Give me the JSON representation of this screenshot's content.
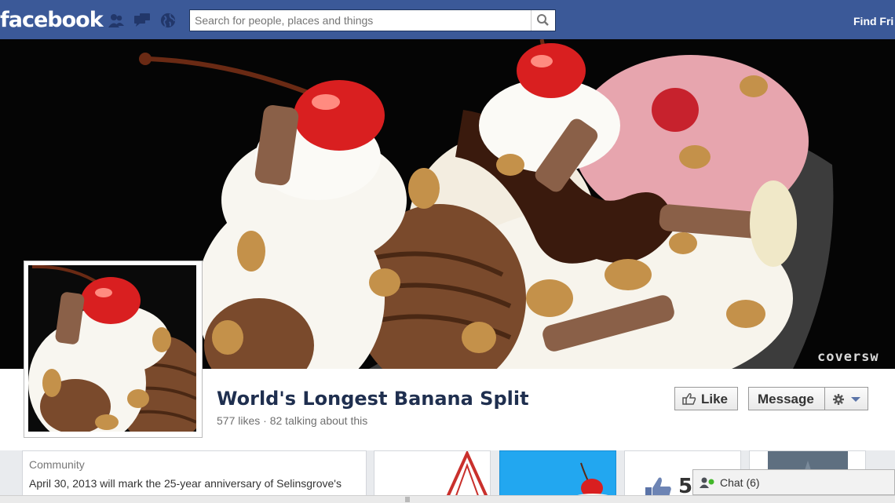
{
  "topbar": {
    "logo": "facebook",
    "search_placeholder": "Search for people, places and things",
    "find_friends": "Find Fri"
  },
  "cover": {
    "watermark": "coversw"
  },
  "page": {
    "name": "World's Longest Banana Split",
    "likes": "577 likes",
    "separator": " · ",
    "talking": "82 talking about this",
    "like_button": "Like",
    "message_button": "Message"
  },
  "about": {
    "category": "Community",
    "description": "April 30, 2013 will mark the 25-year anniversary of Selinsgrove's"
  },
  "apps": {
    "likes_count": "5"
  },
  "chat": {
    "label": "Chat (6)"
  },
  "colors": {
    "brand_blue": "#3b5998",
    "background": "#e9ebee"
  }
}
